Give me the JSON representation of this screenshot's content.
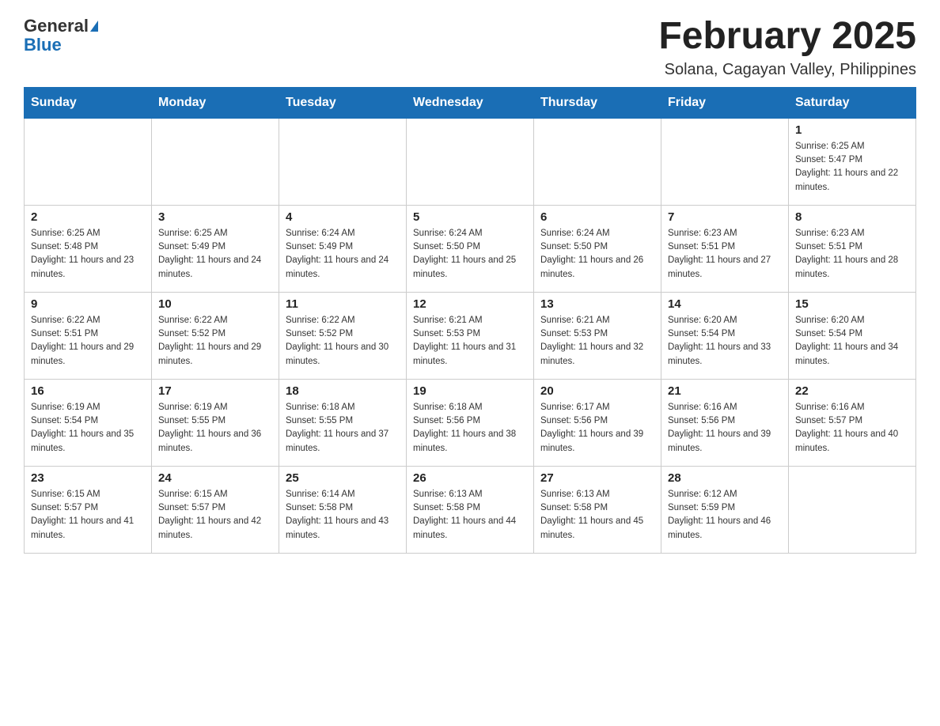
{
  "header": {
    "logo_general": "General",
    "logo_blue": "Blue",
    "title": "February 2025",
    "subtitle": "Solana, Cagayan Valley, Philippines"
  },
  "calendar": {
    "days_of_week": [
      "Sunday",
      "Monday",
      "Tuesday",
      "Wednesday",
      "Thursday",
      "Friday",
      "Saturday"
    ],
    "weeks": [
      [
        {
          "day": "",
          "sunrise": "",
          "sunset": "",
          "daylight": ""
        },
        {
          "day": "",
          "sunrise": "",
          "sunset": "",
          "daylight": ""
        },
        {
          "day": "",
          "sunrise": "",
          "sunset": "",
          "daylight": ""
        },
        {
          "day": "",
          "sunrise": "",
          "sunset": "",
          "daylight": ""
        },
        {
          "day": "",
          "sunrise": "",
          "sunset": "",
          "daylight": ""
        },
        {
          "day": "",
          "sunrise": "",
          "sunset": "",
          "daylight": ""
        },
        {
          "day": "1",
          "sunrise": "Sunrise: 6:25 AM",
          "sunset": "Sunset: 5:47 PM",
          "daylight": "Daylight: 11 hours and 22 minutes."
        }
      ],
      [
        {
          "day": "2",
          "sunrise": "Sunrise: 6:25 AM",
          "sunset": "Sunset: 5:48 PM",
          "daylight": "Daylight: 11 hours and 23 minutes."
        },
        {
          "day": "3",
          "sunrise": "Sunrise: 6:25 AM",
          "sunset": "Sunset: 5:49 PM",
          "daylight": "Daylight: 11 hours and 24 minutes."
        },
        {
          "day": "4",
          "sunrise": "Sunrise: 6:24 AM",
          "sunset": "Sunset: 5:49 PM",
          "daylight": "Daylight: 11 hours and 24 minutes."
        },
        {
          "day": "5",
          "sunrise": "Sunrise: 6:24 AM",
          "sunset": "Sunset: 5:50 PM",
          "daylight": "Daylight: 11 hours and 25 minutes."
        },
        {
          "day": "6",
          "sunrise": "Sunrise: 6:24 AM",
          "sunset": "Sunset: 5:50 PM",
          "daylight": "Daylight: 11 hours and 26 minutes."
        },
        {
          "day": "7",
          "sunrise": "Sunrise: 6:23 AM",
          "sunset": "Sunset: 5:51 PM",
          "daylight": "Daylight: 11 hours and 27 minutes."
        },
        {
          "day": "8",
          "sunrise": "Sunrise: 6:23 AM",
          "sunset": "Sunset: 5:51 PM",
          "daylight": "Daylight: 11 hours and 28 minutes."
        }
      ],
      [
        {
          "day": "9",
          "sunrise": "Sunrise: 6:22 AM",
          "sunset": "Sunset: 5:51 PM",
          "daylight": "Daylight: 11 hours and 29 minutes."
        },
        {
          "day": "10",
          "sunrise": "Sunrise: 6:22 AM",
          "sunset": "Sunset: 5:52 PM",
          "daylight": "Daylight: 11 hours and 29 minutes."
        },
        {
          "day": "11",
          "sunrise": "Sunrise: 6:22 AM",
          "sunset": "Sunset: 5:52 PM",
          "daylight": "Daylight: 11 hours and 30 minutes."
        },
        {
          "day": "12",
          "sunrise": "Sunrise: 6:21 AM",
          "sunset": "Sunset: 5:53 PM",
          "daylight": "Daylight: 11 hours and 31 minutes."
        },
        {
          "day": "13",
          "sunrise": "Sunrise: 6:21 AM",
          "sunset": "Sunset: 5:53 PM",
          "daylight": "Daylight: 11 hours and 32 minutes."
        },
        {
          "day": "14",
          "sunrise": "Sunrise: 6:20 AM",
          "sunset": "Sunset: 5:54 PM",
          "daylight": "Daylight: 11 hours and 33 minutes."
        },
        {
          "day": "15",
          "sunrise": "Sunrise: 6:20 AM",
          "sunset": "Sunset: 5:54 PM",
          "daylight": "Daylight: 11 hours and 34 minutes."
        }
      ],
      [
        {
          "day": "16",
          "sunrise": "Sunrise: 6:19 AM",
          "sunset": "Sunset: 5:54 PM",
          "daylight": "Daylight: 11 hours and 35 minutes."
        },
        {
          "day": "17",
          "sunrise": "Sunrise: 6:19 AM",
          "sunset": "Sunset: 5:55 PM",
          "daylight": "Daylight: 11 hours and 36 minutes."
        },
        {
          "day": "18",
          "sunrise": "Sunrise: 6:18 AM",
          "sunset": "Sunset: 5:55 PM",
          "daylight": "Daylight: 11 hours and 37 minutes."
        },
        {
          "day": "19",
          "sunrise": "Sunrise: 6:18 AM",
          "sunset": "Sunset: 5:56 PM",
          "daylight": "Daylight: 11 hours and 38 minutes."
        },
        {
          "day": "20",
          "sunrise": "Sunrise: 6:17 AM",
          "sunset": "Sunset: 5:56 PM",
          "daylight": "Daylight: 11 hours and 39 minutes."
        },
        {
          "day": "21",
          "sunrise": "Sunrise: 6:16 AM",
          "sunset": "Sunset: 5:56 PM",
          "daylight": "Daylight: 11 hours and 39 minutes."
        },
        {
          "day": "22",
          "sunrise": "Sunrise: 6:16 AM",
          "sunset": "Sunset: 5:57 PM",
          "daylight": "Daylight: 11 hours and 40 minutes."
        }
      ],
      [
        {
          "day": "23",
          "sunrise": "Sunrise: 6:15 AM",
          "sunset": "Sunset: 5:57 PM",
          "daylight": "Daylight: 11 hours and 41 minutes."
        },
        {
          "day": "24",
          "sunrise": "Sunrise: 6:15 AM",
          "sunset": "Sunset: 5:57 PM",
          "daylight": "Daylight: 11 hours and 42 minutes."
        },
        {
          "day": "25",
          "sunrise": "Sunrise: 6:14 AM",
          "sunset": "Sunset: 5:58 PM",
          "daylight": "Daylight: 11 hours and 43 minutes."
        },
        {
          "day": "26",
          "sunrise": "Sunrise: 6:13 AM",
          "sunset": "Sunset: 5:58 PM",
          "daylight": "Daylight: 11 hours and 44 minutes."
        },
        {
          "day": "27",
          "sunrise": "Sunrise: 6:13 AM",
          "sunset": "Sunset: 5:58 PM",
          "daylight": "Daylight: 11 hours and 45 minutes."
        },
        {
          "day": "28",
          "sunrise": "Sunrise: 6:12 AM",
          "sunset": "Sunset: 5:59 PM",
          "daylight": "Daylight: 11 hours and 46 minutes."
        },
        {
          "day": "",
          "sunrise": "",
          "sunset": "",
          "daylight": ""
        }
      ]
    ]
  }
}
